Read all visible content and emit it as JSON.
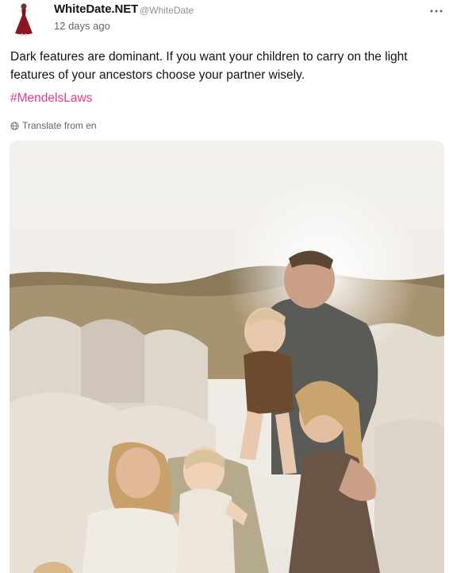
{
  "author": {
    "name": "WhiteDate.NET",
    "handle": "@WhiteDate",
    "avatar_icon": "woman-in-red-dress-icon"
  },
  "post": {
    "timestamp": "12 days ago",
    "text": "Dark features are dominant. If you want your children to carry on the light features of your ancestors choose your partner wisely.",
    "hashtag": "#MendelsLaws",
    "translate_label": "Translate from en",
    "more_icon": "ellipsis-icon"
  },
  "colors": {
    "hashtag": "#d93d91",
    "muted": "#5b6670",
    "text": "#0f1419"
  }
}
